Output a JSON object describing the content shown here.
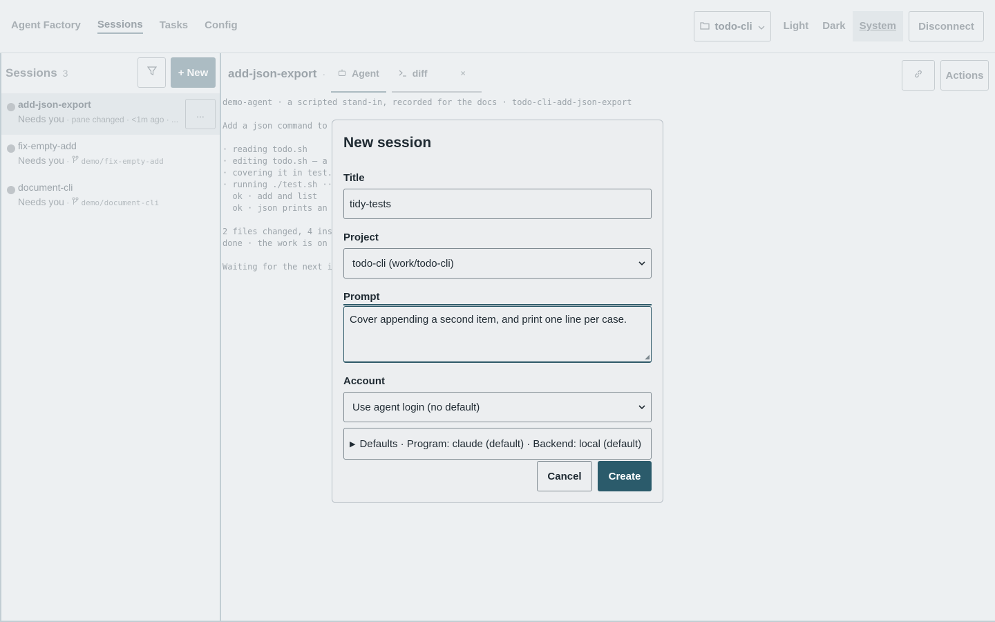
{
  "topnav": {
    "brand": "Agent Factory",
    "items": [
      "Sessions",
      "Tasks",
      "Config"
    ],
    "project": "todo-cli",
    "themes": [
      "Light",
      "Dark",
      "System"
    ],
    "disconnect": "Disconnect"
  },
  "sidebar": {
    "title": "Sessions",
    "count": "3",
    "new_label": "New",
    "more_label": "...",
    "sessions": [
      {
        "name": "add-json-export",
        "status": "Needs you",
        "detail": " · pane changed · <1m ago · ..."
      },
      {
        "name": "fix-empty-add",
        "status": "Needs you",
        "sep": " · ",
        "branch": "demo/fix-empty-add"
      },
      {
        "name": "document-cli",
        "status": "Needs you",
        "sep": " · ",
        "branch": "demo/document-cli"
      }
    ]
  },
  "main": {
    "title": "add-json-export",
    "sep": "·",
    "tab_agent": "Agent",
    "tab_diff": "diff",
    "tab_close": "×",
    "actions": "Actions",
    "terminal": "demo-agent · a scripted stand-in, recorded for the docs · todo-cli-add-json-export\n\nAdd a json command to to\n\n· reading todo.sh\n· editing todo.sh — a js\n· covering it in test.sh\n· running ./test.sh ···\n  ok · add and list\n  ok · json prints an ar\n\n2 files changed, 4 inser\ndone · the work is on de\n\nWaiting for the next ins"
  },
  "modal": {
    "heading": "New session",
    "title_label": "Title",
    "title_value": "tidy-tests",
    "project_label": "Project",
    "project_value": "todo-cli (work/todo-cli)",
    "prompt_label": "Prompt",
    "prompt_value": "Cover appending a second item, and print one line per case.",
    "account_label": "Account",
    "account_value": "Use agent login (no default)",
    "defaults_summary": "Defaults · Program: claude (default) · Backend: local (default)",
    "cancel": "Cancel",
    "create": "Create"
  }
}
